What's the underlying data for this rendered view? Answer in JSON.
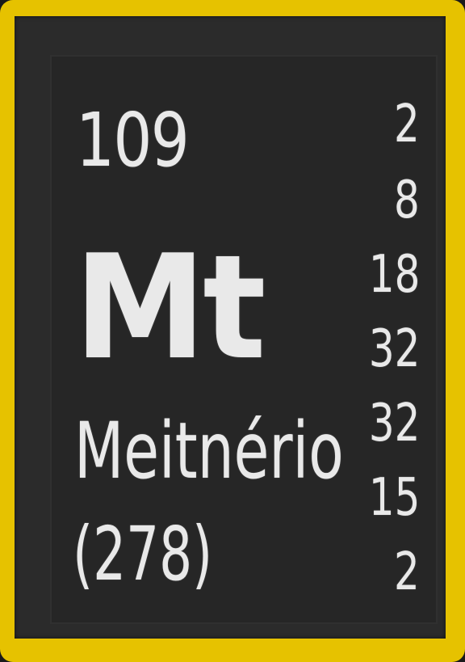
{
  "element": {
    "atomic_number": "109",
    "symbol": "Mt",
    "name": "Meitnério",
    "atomic_mass": "(278)",
    "electron_shells": [
      "2",
      "8",
      "18",
      "32",
      "32",
      "15",
      "2"
    ]
  },
  "colors": {
    "frame": "#e6c200",
    "tile": "#262626",
    "text": "#e9e9e9"
  }
}
